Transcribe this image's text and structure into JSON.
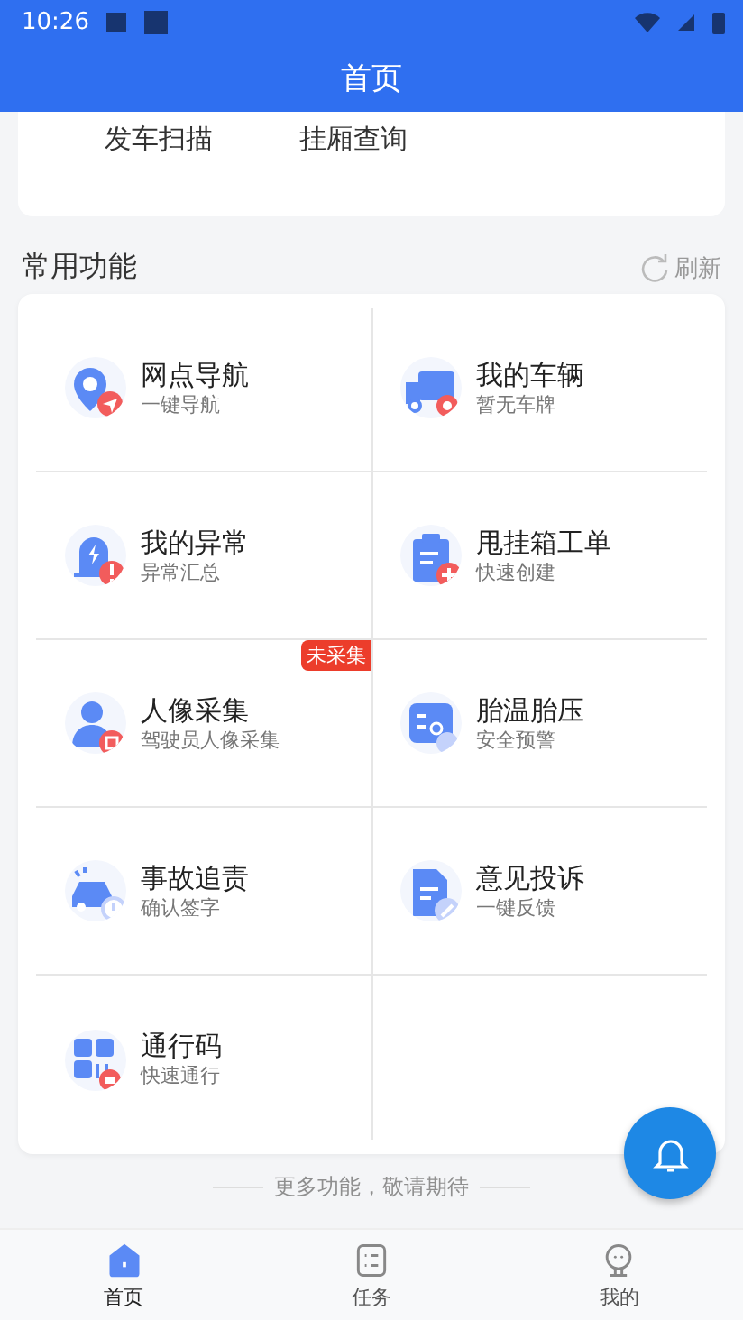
{
  "status_bar": {
    "time": "10:26"
  },
  "header": {
    "title": "首页"
  },
  "top_card": {
    "items": [
      "发车扫描",
      "挂厢查询"
    ]
  },
  "section": {
    "title": "常用功能",
    "action": "刷新"
  },
  "functions": [
    {
      "title": "网点导航",
      "subtitle": "一键导航"
    },
    {
      "title": "我的车辆",
      "subtitle": "暂无车牌"
    },
    {
      "title": "我的异常",
      "subtitle": "异常汇总"
    },
    {
      "title": "甩挂箱工单",
      "subtitle": "快速创建"
    },
    {
      "title": "人像采集",
      "subtitle": "驾驶员人像采集",
      "badge": "未采集"
    },
    {
      "title": "胎温胎压",
      "subtitle": "安全预警"
    },
    {
      "title": "事故追责",
      "subtitle": "确认签字"
    },
    {
      "title": "意见投诉",
      "subtitle": "一键反馈"
    },
    {
      "title": "通行码",
      "subtitle": "快速通行"
    }
  ],
  "footer_note": "更多功能，敬请期待",
  "nav": [
    {
      "label": "首页",
      "selected": true
    },
    {
      "label": "任务",
      "selected": false
    },
    {
      "label": "我的",
      "selected": false
    }
  ]
}
